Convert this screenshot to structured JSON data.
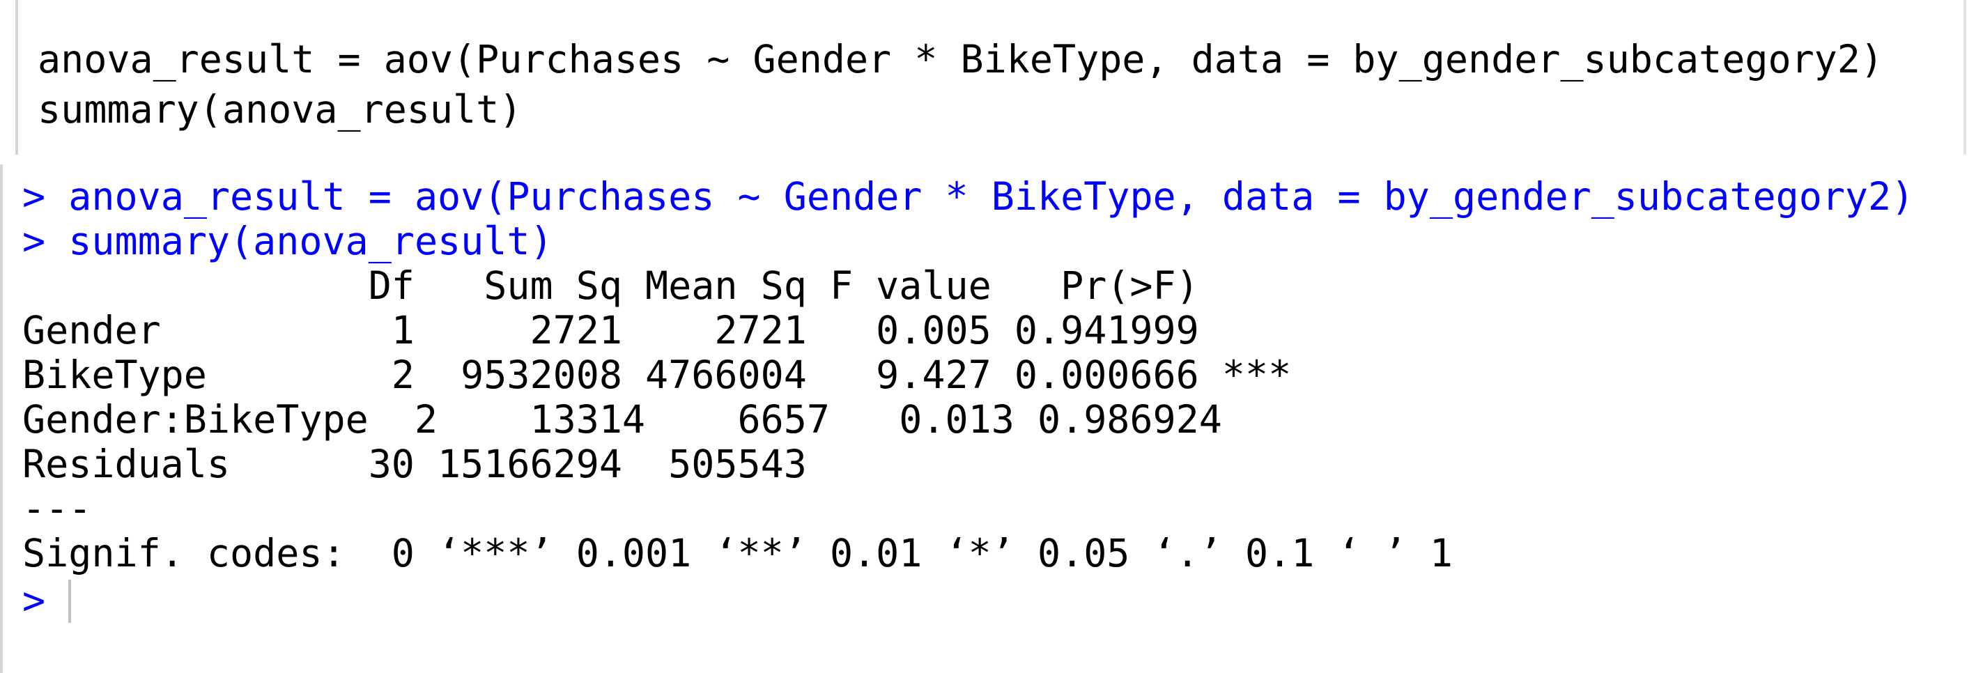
{
  "editor": {
    "lines": [
      "anova_result = aov(Purchases ~ Gender * BikeType, data = by_gender_subcategory2)",
      "summary(anova_result)"
    ]
  },
  "console": {
    "prompt": ">",
    "commands": [
      "anova_result = aov(Purchases ~ Gender * BikeType, data = by_gender_subcategory2)",
      "summary(anova_result)"
    ],
    "anova_table": {
      "header": "               Df   Sum Sq Mean Sq F value   Pr(>F)    ",
      "rows": [
        "Gender          1     2721    2721   0.005 0.941999    ",
        "BikeType        2  9532008 4766004   9.427 0.000666 ***",
        "Gender:BikeType  2    13314    6657   0.013 0.986924    ",
        "Residuals      30 15166294  505543                    "
      ],
      "separator": "---",
      "signif_codes": "Signif. codes:  0 ‘***’ 0.001 ‘**’ 0.01 ‘*’ 0.05 ‘.’ 0.1 ‘ ’ 1"
    },
    "columns": [
      "Df",
      "Sum Sq",
      "Mean Sq",
      "F value",
      "Pr(>F)"
    ],
    "terms": [
      {
        "term": "Gender",
        "df": "1",
        "sum_sq": "2721",
        "mean_sq": "2721",
        "f_value": "0.005",
        "p": "0.941999",
        "signif": ""
      },
      {
        "term": "BikeType",
        "df": "2",
        "sum_sq": "9532008",
        "mean_sq": "4766004",
        "f_value": "9.427",
        "p": "0.000666",
        "signif": "***"
      },
      {
        "term": "Gender:BikeType",
        "df": "2",
        "sum_sq": "13314",
        "mean_sq": "6657",
        "f_value": "0.013",
        "p": "0.986924",
        "signif": ""
      },
      {
        "term": "Residuals",
        "df": "30",
        "sum_sq": "15166294",
        "mean_sq": "505543",
        "f_value": "",
        "p": "",
        "signif": ""
      }
    ]
  },
  "colors": {
    "command_text": "#0000ff",
    "output_text": "#000000",
    "background": "#ffffff"
  }
}
